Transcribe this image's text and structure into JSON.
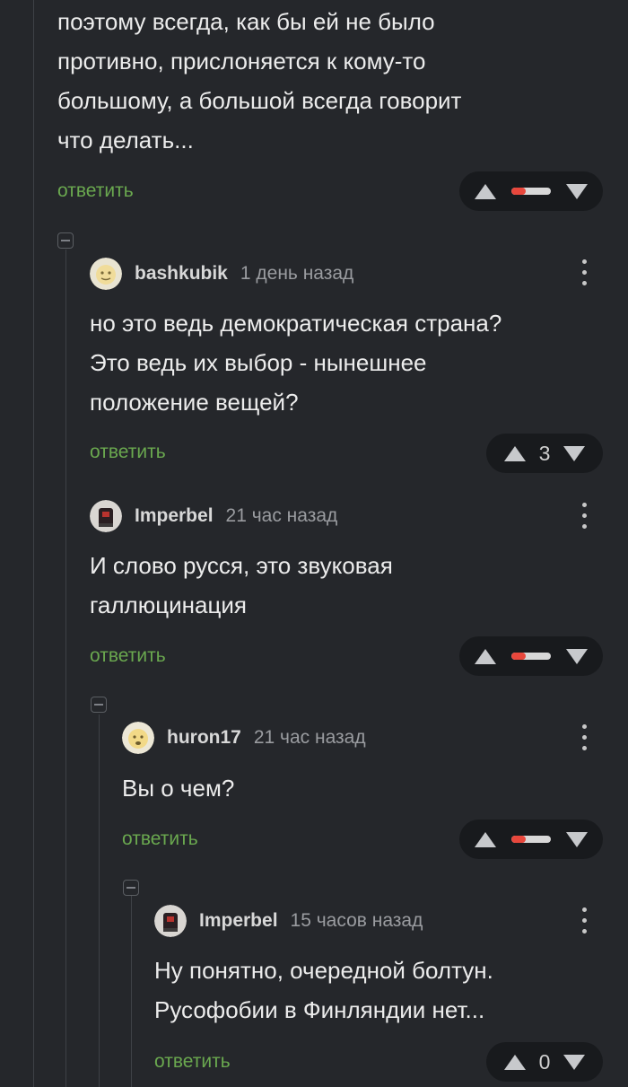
{
  "top_comment": {
    "text_lines": [
      "поэтому всегда, как бы ей не было",
      "противно, прислоняется к кому-то",
      "большому, а большой всегда говорит",
      "что делать..."
    ],
    "reply_label": "ответить"
  },
  "comments": [
    {
      "username": "bashkubik",
      "time": "1 день назад",
      "text_lines": [
        "но это ведь демократическая страна?",
        "Это ведь их выбор - нынешнее",
        "положение вещей?"
      ],
      "reply_label": "ответить",
      "rating": "3"
    },
    {
      "username": "Imperbel",
      "time": "21 час назад",
      "text_lines": [
        "И слово русся, это звуковая",
        "галлюцинация"
      ],
      "reply_label": "ответить"
    },
    {
      "username": "huron17",
      "time": "21 час назад",
      "text_lines": [
        "Вы о чем?"
      ],
      "reply_label": "ответить"
    },
    {
      "username": "Imperbel",
      "time": "15 часов назад",
      "text_lines": [
        "Ну понятно, очередной болтун.",
        "Русофобии в Финляндии нет..."
      ],
      "reply_label": "ответить",
      "rating": "0"
    }
  ],
  "colors": {
    "background": "#25272b",
    "reply_link": "#6aa84f",
    "vote_pill": "#181a1d",
    "negative_rating": "#e8473c"
  },
  "icons": {
    "upvote": "triangle-up",
    "downvote": "triangle-down",
    "menu": "vertical-dots",
    "collapse": "minus-square"
  }
}
